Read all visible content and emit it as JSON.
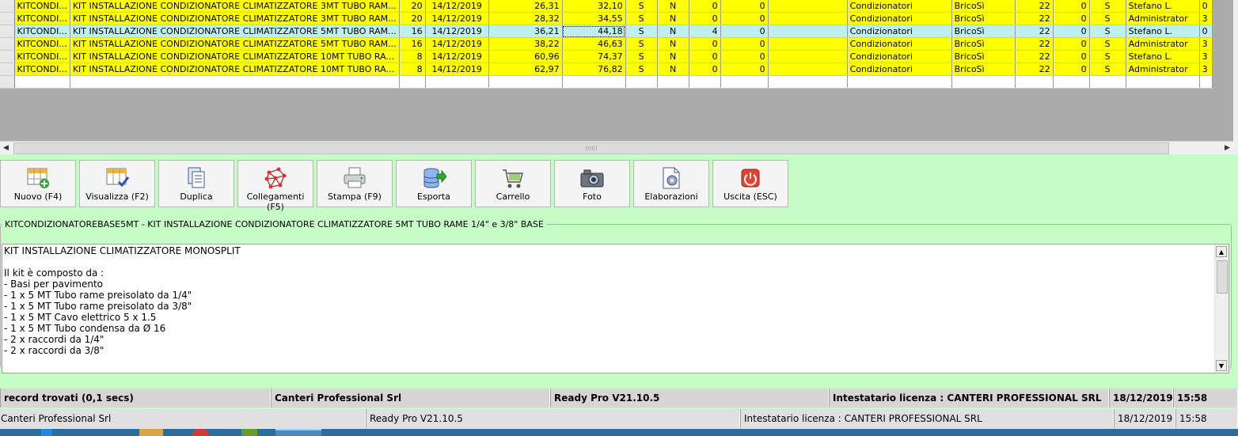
{
  "grid": {
    "rows": [
      {
        "style": "yellow",
        "cells": [
          "",
          "KITCONDI...",
          "KIT INSTALLAZIONE CONDIZIONATORE CLIMATIZZATORE 3MT TUBO RAM...",
          "20",
          "14/12/2019",
          "26,31",
          "32,10",
          "S",
          "N",
          "0",
          "0",
          "",
          "Condizionatori",
          "BricoSì",
          "22",
          "0",
          "S",
          "Stefano L.",
          "0"
        ]
      },
      {
        "style": "yellow",
        "cells": [
          "",
          "KITCONDI...",
          "KIT INSTALLAZIONE CONDIZIONATORE CLIMATIZZATORE 3MT TUBO RAM...",
          "20",
          "14/12/2019",
          "28,32",
          "34,55",
          "S",
          "N",
          "0",
          "0",
          "",
          "Condizionatori",
          "BricoSì",
          "22",
          "0",
          "S",
          "Administrator",
          "3"
        ]
      },
      {
        "style": "sel",
        "cells": [
          "",
          "KITCONDI...",
          "KIT INSTALLAZIONE CONDIZIONATORE CLIMATIZZATORE 5MT TUBO RAM...",
          "16",
          "14/12/2019",
          "36,21",
          "44,18",
          "S",
          "N",
          "4",
          "0",
          "",
          "Condizionatori",
          "BricoSì",
          "22",
          "0",
          "S",
          "Stefano L.",
          "0"
        ]
      },
      {
        "style": "yellow",
        "cells": [
          "",
          "KITCONDI...",
          "KIT INSTALLAZIONE CONDIZIONATORE CLIMATIZZATORE 5MT TUBO RAM...",
          "16",
          "14/12/2019",
          "38,22",
          "46,63",
          "S",
          "N",
          "0",
          "0",
          "",
          "Condizionatori",
          "BricoSì",
          "22",
          "0",
          "S",
          "Administrator",
          "3"
        ]
      },
      {
        "style": "yellow",
        "cells": [
          "",
          "KITCONDI...",
          "KIT INSTALLAZIONE CONDIZIONATORE CLIMATIZZATORE 10MT TUBO RA...",
          "8",
          "14/12/2019",
          "60,96",
          "74,37",
          "S",
          "N",
          "0",
          "0",
          "",
          "Condizionatori",
          "BricoSì",
          "22",
          "0",
          "S",
          "Stefano L.",
          "3"
        ]
      },
      {
        "style": "yellow",
        "cells": [
          "",
          "KITCONDI...",
          "KIT INSTALLAZIONE CONDIZIONATORE CLIMATIZZATORE 10MT TUBO RA...",
          "8",
          "14/12/2019",
          "62,97",
          "76,82",
          "S",
          "N",
          "0",
          "0",
          "",
          "Condizionatori",
          "BricoSì",
          "22",
          "0",
          "S",
          "Administrator",
          "3"
        ]
      },
      {
        "style": "empty",
        "cells": [
          "",
          "",
          "",
          "",
          "",
          "",
          "",
          "",
          "",
          "",
          "",
          "",
          "",
          "",
          "",
          "",
          "",
          "",
          ""
        ]
      }
    ]
  },
  "toolbar": {
    "buttons": [
      {
        "label": "Nuovo (F4)",
        "icon": "new-grid-icon"
      },
      {
        "label": "Visualizza (F2)",
        "icon": "view-grid-icon"
      },
      {
        "label": "Duplica",
        "icon": "duplicate-icon"
      },
      {
        "label": "Collegamenti (F5)",
        "icon": "links-icon"
      },
      {
        "label": "Stampa (F9)",
        "icon": "printer-icon"
      },
      {
        "label": "Esporta",
        "icon": "export-icon"
      },
      {
        "label": "Carrello",
        "icon": "cart-icon"
      },
      {
        "label": "Foto",
        "icon": "camera-icon"
      },
      {
        "label": "Elaborazioni",
        "icon": "processing-icon"
      },
      {
        "label": "Uscita (ESC)",
        "icon": "power-icon"
      }
    ]
  },
  "description": {
    "legend": "KITCONDIZIONATOREBASE5MT - KIT INSTALLAZIONE CONDIZIONATORE CLIMATIZZATORE 5MT TUBO RAME 1/4\" e 3/8\" BASE",
    "text": "KIT INSTALLAZIONE CLIMATIZZATORE MONOSPLIT\n\nIl kit è composto da :\n- Basi per pavimento\n- 1 x 5 MT Tubo rame preisolato da 1/4\"\n- 1 x 5 MT Tubo rame preisolato da 3/8\"\n- 1 x 5 MT Cavo elettrico 5 x 1.5\n- 1 x 5 MT Tubo condensa da Ø 16\n- 2 x raccordi da 1/4\"\n- 2 x raccordi da 3/8\""
  },
  "status_bar_1": {
    "records": "record trovati (0,1 secs)",
    "company": "Canteri Professional Srl",
    "version": "Ready Pro V21.10.5",
    "license": "Intestatario licenza : CANTERI PROFESSIONAL SRL",
    "date": "18/12/2019",
    "time": "15:58"
  },
  "status_bar_2": {
    "company": "Canteri Professional Srl",
    "version": "Ready Pro V21.10.5",
    "license": "Intestatario licenza : CANTERI PROFESSIONAL SRL",
    "date": "18/12/2019",
    "time": "15:58"
  },
  "colors": {
    "highlight_row": "#ffff00",
    "selected_row": "#bff0f0",
    "background": "#c6fcc6"
  }
}
